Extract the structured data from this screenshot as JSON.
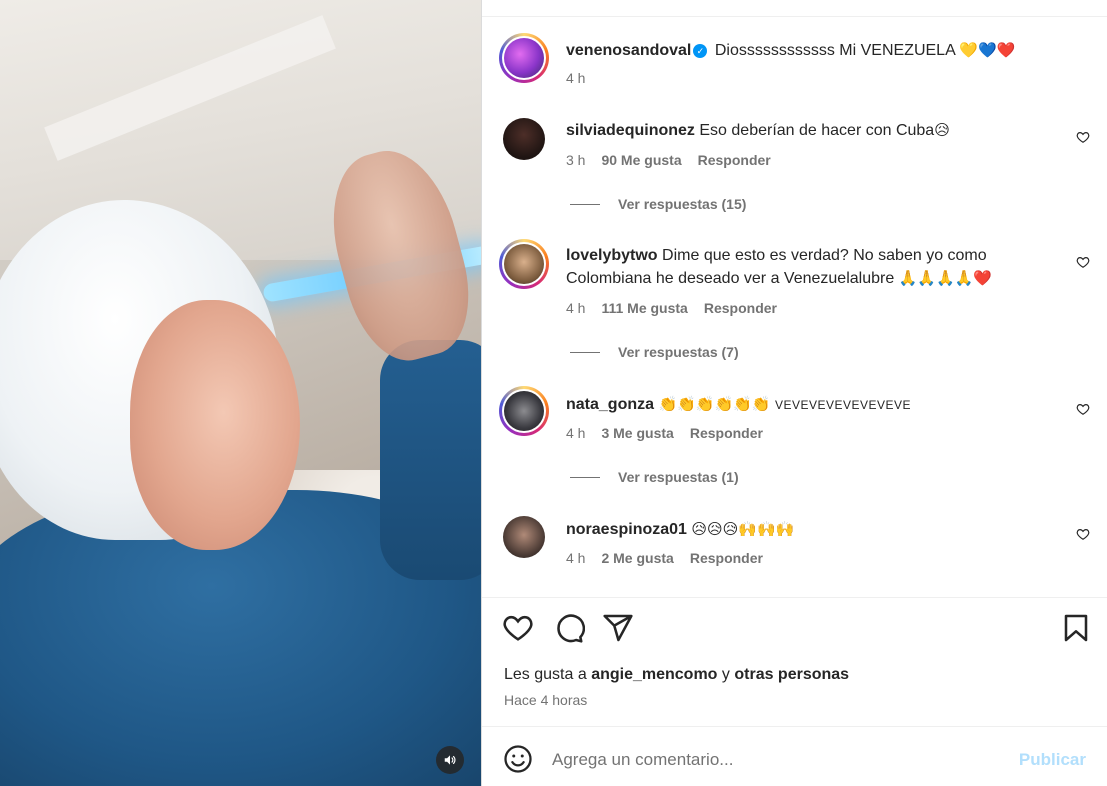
{
  "media": {
    "mute_icon": "speaker-icon"
  },
  "post": {
    "author": "venenosandoval",
    "verified": true,
    "caption": "Diossssssssssss Mi VENEZUELA",
    "caption_emojis": "💛💙❤️",
    "time": "4 h"
  },
  "comments": [
    {
      "user": "silviadequinonez",
      "text": "Eso deberían de hacer con Cuba",
      "emoji": "😥",
      "time": "3 h",
      "likes": "90 Me gusta",
      "reply": "Responder",
      "view_replies": "Ver respuestas (15)"
    },
    {
      "user": "lovelybytwo",
      "text": "Dime que esto es verdad? No saben yo como",
      "text2": "Colombiana he deseado ver a Venezuelalubre",
      "emoji": "🙏🙏🙏🙏❤️",
      "time": "4 h",
      "likes": "111 Me gusta",
      "reply": "Responder",
      "view_replies": "Ver respuestas (7)"
    },
    {
      "user": "nata_gonza",
      "text": "VEVEVEVEVEVEVEVE",
      "emoji": "👏👏👏👏👏👏",
      "time": "4 h",
      "likes": "3 Me gusta",
      "reply": "Responder",
      "view_replies": "Ver respuestas (1)"
    },
    {
      "user": "noraespinoza01",
      "text": "",
      "emoji": "😥😥😥🙌🙌🙌",
      "time": "4 h",
      "likes": "2 Me gusta",
      "reply": "Responder"
    }
  ],
  "actions": {
    "like_icon": "heart-icon",
    "comment_icon": "comment-icon",
    "share_icon": "share-icon",
    "save_icon": "bookmark-icon"
  },
  "likes_summary": {
    "prefix": "Les gusta a",
    "user": "angie_mencomo",
    "joiner": "y",
    "others": "otras personas"
  },
  "post_time": "Hace 4 horas",
  "comment_box": {
    "placeholder": "Agrega un comentario...",
    "publish": "Publicar"
  },
  "colors": {
    "link_blue": "#0095f6",
    "publish_disabled": "#b2dffc",
    "muted_text": "#737373"
  }
}
